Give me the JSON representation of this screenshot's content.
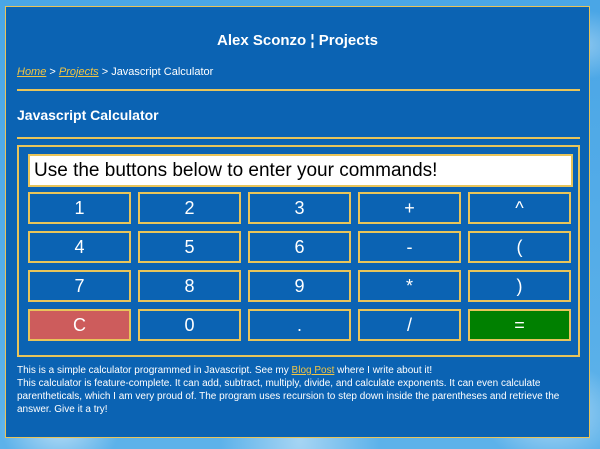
{
  "site": {
    "title": "Alex Sconzo ¦ Projects"
  },
  "breadcrumb": {
    "home": "Home",
    "sep1": " > ",
    "projects": "Projects",
    "sep2": " > ",
    "current": "Javascript Calculator"
  },
  "section": {
    "title": "Javascript Calculator"
  },
  "calculator": {
    "display": "Use the buttons below to enter your commands!",
    "keys": [
      "1",
      "2",
      "3",
      "+",
      "^",
      "4",
      "5",
      "6",
      "-",
      "(",
      "7",
      "8",
      "9",
      "*",
      ")",
      "C",
      "0",
      ".",
      "/",
      "="
    ],
    "colors": {
      "clear": "#cd5c5c",
      "equals": "#008000",
      "key": "#0b63b3",
      "border": "#e8c45a"
    }
  },
  "description": {
    "line1_pre": "This is a simple calculator programmed in Javascript. See my ",
    "line1_link": "Blog Post",
    "line1_post": " where I write about it!",
    "line2": "This calculator is feature-complete. It can add, subtract, multiply, divide, and calculate exponents. It can even calculate parentheticals, which I am very proud of. The program uses recursion to step down inside the parentheses and retrieve the answer. Give it a try!"
  }
}
